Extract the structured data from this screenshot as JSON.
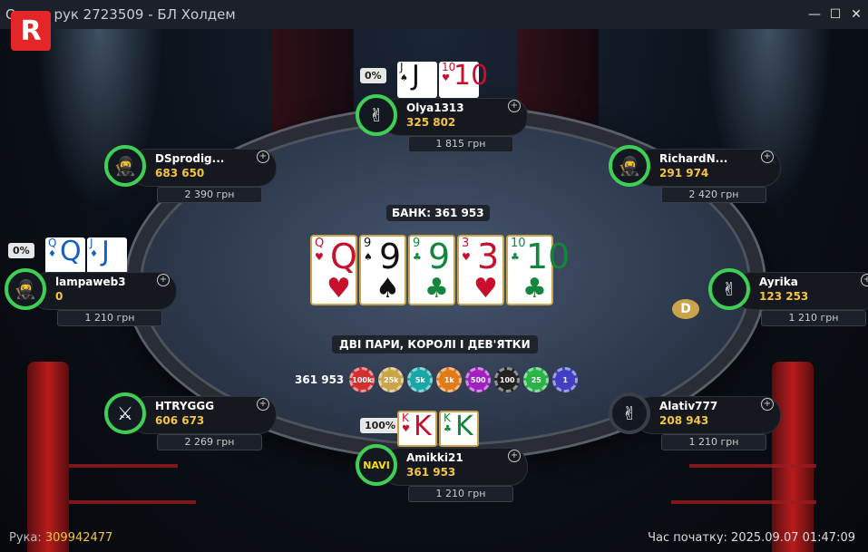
{
  "window": {
    "title": "Огляд рук 2723509 - БЛ Холдем",
    "minimize": "—",
    "maximize": "☐",
    "close": "✕"
  },
  "logo": "R",
  "pot": "БАНК: 361 953",
  "hand_name": "ДВІ ПАРИ, КОРОЛІ І ДЕВ'ЯТКИ",
  "board": [
    {
      "rank": "Q",
      "suit": "♥",
      "color": "#c8102e"
    },
    {
      "rank": "9",
      "suit": "♠",
      "color": "#111111"
    },
    {
      "rank": "9",
      "suit": "♣",
      "color": "#14853d"
    },
    {
      "rank": "3",
      "suit": "♥",
      "color": "#c8102e"
    },
    {
      "rank": "10",
      "suit": "♣",
      "color": "#14853d"
    }
  ],
  "chips": {
    "amount": "361 953",
    "stack": [
      {
        "label": "100k",
        "color": "#d03030"
      },
      {
        "label": "25k",
        "color": "#c9a44a"
      },
      {
        "label": "5k",
        "color": "#1aa6a6"
      },
      {
        "label": "1k",
        "color": "#e07b1a"
      },
      {
        "label": "500",
        "color": "#a020c0"
      },
      {
        "label": "100",
        "color": "#222222"
      },
      {
        "label": "25",
        "color": "#2bb34a"
      },
      {
        "label": "1",
        "color": "#4040c0"
      }
    ]
  },
  "players": [
    {
      "name": "Olya1313",
      "stack": "325 802",
      "bounty": "1 815 грн",
      "equity": "0%",
      "avatar": "vbet-icon",
      "cards": [
        {
          "rank": "J",
          "suit": "♠",
          "color": "#111111"
        },
        {
          "rank": "10",
          "suit": "♥",
          "color": "#c8102e"
        }
      ]
    },
    {
      "name": "DSprodig...",
      "stack": "683 650",
      "bounty": "2 390 грн",
      "avatar": "ninja-icon"
    },
    {
      "name": "RichardN...",
      "stack": "291 974",
      "bounty": "2 420 грн",
      "avatar": "ninja-icon"
    },
    {
      "name": "lampaweb3",
      "stack": "0",
      "bounty": "1 210 грн",
      "equity": "0%",
      "avatar": "ninja-icon",
      "cards": [
        {
          "rank": "Q",
          "suit": "♦",
          "color": "#1461c4"
        },
        {
          "rank": "J",
          "suit": "♦",
          "color": "#1461c4"
        }
      ]
    },
    {
      "name": "Ayrika",
      "stack": "123 253",
      "bounty": "1 210 грн",
      "avatar": "vbet-icon"
    },
    {
      "name": "HTRYGGG",
      "stack": "606 673",
      "bounty": "2 269 грн",
      "avatar": "warrior-icon"
    },
    {
      "name": "Alativ777",
      "stack": "208 943",
      "bounty": "1 210 грн",
      "avatar": "vbet-icon"
    },
    {
      "name": "Amikki21",
      "stack": "361 953",
      "bounty": "1 210 грн",
      "equity": "100%",
      "avatar": "navi-icon",
      "cards": [
        {
          "rank": "K",
          "suit": "♥",
          "color": "#c8102e"
        },
        {
          "rank": "K",
          "suit": "♣",
          "color": "#14853d"
        }
      ]
    }
  ],
  "dealer": "D",
  "footer": {
    "hand_label": "Рука:",
    "hand_id": "309942477",
    "start_label": "Час початку:",
    "start_time": "2025.09.07 01:47:09"
  }
}
